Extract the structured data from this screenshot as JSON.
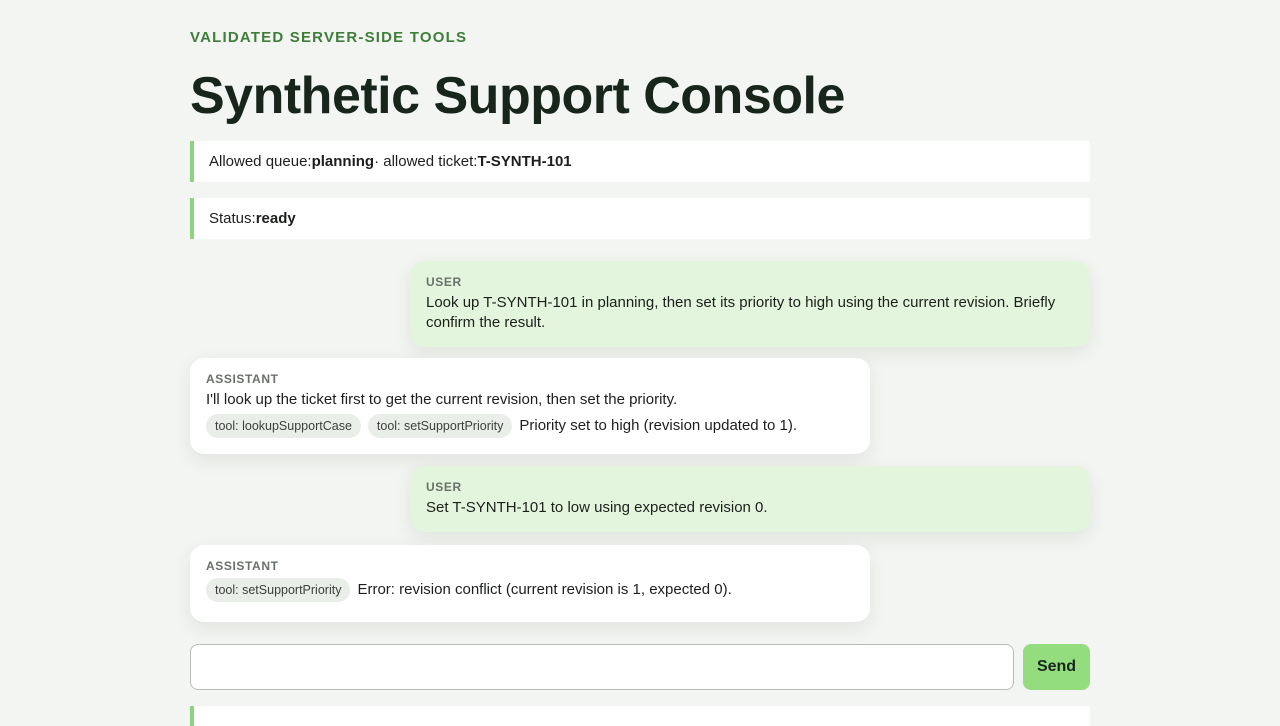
{
  "header": {
    "eyebrow": "VALIDATED SERVER-SIDE TOOLS",
    "title": "Synthetic Support Console"
  },
  "notices": {
    "scope": {
      "queue_label": "Allowed queue: ",
      "queue_value": "planning",
      "sep": " · allowed ticket: ",
      "ticket_value": "T-SYNTH-101"
    },
    "status": {
      "label": "Status: ",
      "value": "ready"
    }
  },
  "messages": [
    {
      "role": "USER",
      "text": "Look up T-SYNTH-101 in planning, then set its priority to high using the current revision. Briefly confirm the result."
    },
    {
      "role": "ASSISTANT",
      "text": "I'll look up the ticket first to get the current revision, then set the priority.",
      "tools": [
        "tool: lookupSupportCase",
        "tool: setSupportPriority"
      ],
      "result": "Priority set to high (revision updated to 1)."
    },
    {
      "role": "USER",
      "text": "Set T-SYNTH-101 to low using expected revision 0."
    },
    {
      "role": "ASSISTANT",
      "tools": [
        "tool: setSupportPriority"
      ],
      "result": "Error: revision conflict (current revision is 1, expected 0)."
    }
  ],
  "composer": {
    "value": "",
    "placeholder": "",
    "send_label": "Send"
  },
  "colors": {
    "accent": "#93dd7f",
    "notice_border": "#8fd27d",
    "user_bubble": "#e3f5dc",
    "eyebrow": "#3f7d3a"
  }
}
